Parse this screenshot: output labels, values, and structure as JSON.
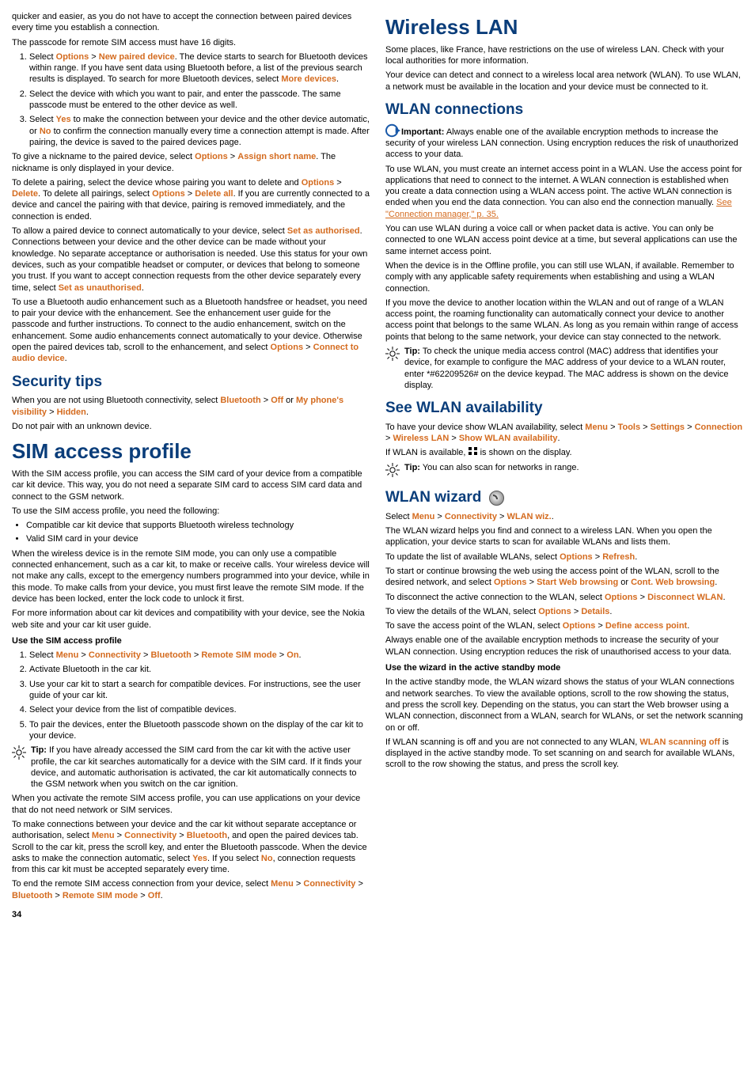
{
  "left": {
    "intro1": "quicker and easier, as you do not have to accept the connection between paired devices every time you establish a connection.",
    "intro2": "The passcode for remote SIM access must have 16 digits.",
    "pair_steps": {
      "s1a": "Select ",
      "s1_opt": "Options",
      "s1_gt1": " > ",
      "s1_npd": "New paired device",
      "s1b": ". The device starts to search for Bluetooth devices within range. If you have sent data using Bluetooth before, a list of the previous search results is displayed. To search for more Bluetooth devices, select ",
      "s1_more": "More devices",
      "s1c": ".",
      "s2": "Select the device with which you want to pair, and enter the passcode. The same passcode must be entered to the other device as well.",
      "s3a": "Select ",
      "s3_yes": "Yes",
      "s3b": " to make the connection between your device and the other device automatic, or ",
      "s3_no": "No",
      "s3c": " to confirm the connection manually every time a connection attempt is made. After pairing, the device is saved to the paired devices page."
    },
    "nick_a": "To give a nickname to the paired device, select ",
    "nick_opt": "Options",
    "nick_gt": " > ",
    "nick_asn": "Assign short name",
    "nick_b": ". The nickname is only displayed in your device.",
    "del_a": "To delete a pairing, select the device whose pairing you want to delete and ",
    "del_opt1": "Options",
    "del_gt1": " > ",
    "del_del": "Delete",
    "del_b": ". To delete all pairings, select ",
    "del_opt2": "Options",
    "del_gt2": " > ",
    "del_da": "Delete all",
    "del_c": ". If you are currently connected to a device and cancel the pairing with that device, pairing is removed immediately, and the connection is ended.",
    "auth_a": "To allow a paired device to connect automatically to your device, select ",
    "auth_sa": "Set as authorised",
    "auth_b": ". Connections between your device and the other device can be made without your knowledge. No separate acceptance or authorisation is needed. Use this status for your own devices, such as your compatible headset or computer, or devices that belong to someone you trust. If you want to accept connection requests from the other device separately every time, select ",
    "auth_su": "Set as unauthorised",
    "auth_c": ".",
    "audio_a": "To use a Bluetooth audio enhancement such as a Bluetooth handsfree or headset, you need to pair your device with the enhancement. See the enhancement user guide for the passcode and further instructions. To connect to the audio enhancement, switch on the enhancement. Some audio enhancements connect automatically to your device. Otherwise open the paired devices tab, scroll to the enhancement, and select ",
    "audio_opt": "Options",
    "audio_gt": " > ",
    "audio_cad": "Connect to audio device",
    "audio_b": ".",
    "sec_h": "Security tips",
    "sec_a": "When you are not using Bluetooth connectivity, select ",
    "sec_bt": "Bluetooth",
    "sec_gt1": " > ",
    "sec_off": "Off",
    "sec_or": " or ",
    "sec_vis": "My phone's visibility",
    "sec_gt2": " > ",
    "sec_hid": "Hidden",
    "sec_b": ".",
    "sec_c": "Do not pair with an unknown device.",
    "sim_h": "SIM access profile",
    "sim_p1": "With the SIM access profile, you can access the SIM card of your device from a compatible car kit device. This way, you do not need a separate SIM card to access SIM card data and connect to the GSM network.",
    "sim_p2": "To use the SIM access profile, you need the following:",
    "sim_b1": "Compatible car kit device that supports Bluetooth wireless technology",
    "sim_b2": "Valid SIM card in your device",
    "sim_p3": "When the wireless device is in the remote SIM mode, you can only use a compatible connected enhancement, such as a car kit, to make or receive calls. Your wireless device will not make any calls, except to the emergency numbers programmed into your device, while in this mode. To make calls from your device, you must first leave the remote SIM mode. If the device has been locked, enter the lock code to unlock it first.",
    "sim_p4": "For more information about car kit devices and compatibility with your device, see the Nokia web site and your car kit user guide.",
    "sim_h3": "Use the SIM access profile",
    "sim_s1a": "Select ",
    "sim_menu": "Menu",
    "sim_gt1": " > ",
    "sim_conn": "Connectivity",
    "sim_gt2": " > ",
    "sim_bt": "Bluetooth",
    "sim_gt3": " > ",
    "sim_rsm": "Remote SIM mode",
    "sim_gt4": " > ",
    "sim_on": "On",
    "sim_s1b": ".",
    "sim_s2": "Activate Bluetooth in the car kit.",
    "sim_s3": "Use your car kit to start a search for compatible devices. For instructions, see the user guide of your car kit.",
    "sim_s4": "Select your device from the list of compatible devices.",
    "sim_s5": "To pair the devices, enter the Bluetooth passcode shown on the display of the car kit to your device.",
    "sim_tip_l": "Tip:",
    "sim_tip": " If you have already accessed the SIM card from the car kit with the active user profile, the car kit searches automatically for a device with the SIM card. If it finds your device, and automatic authorisation is activated, the car kit automatically connects to the GSM network when you switch on the car ignition.",
    "sim_p5": "When you activate the remote SIM access profile, you can use applications on your device that do not need network or SIM services.",
    "sim_p6a": "To make connections between your device and the car kit without separate acceptance or authorisation, select ",
    "p6_menu": "Menu",
    "p6_gt1": " > ",
    "p6_conn": "Connectivity",
    "p6_gt2": " > ",
    "p6_bt": "Bluetooth",
    "sim_p6b": ", and open the paired devices tab. Scroll to the car kit, press the scroll key, and enter the Bluetooth passcode. When the device asks to make the connection automatic, select ",
    "p6_yes": "Yes",
    "sim_p6c": ". If you select ",
    "p6_no": "No",
    "sim_p6d": ", connection requests from this car kit must be accepted separately every time.",
    "sim_p7a": "To end the remote SIM access connection from your device, select ",
    "p7_menu": "Menu",
    "p7_gt1": " > ",
    "p7_conn": "Connectivity",
    "p7_gt2": " > ",
    "p7_bt": "Bluetooth",
    "p7_gt3": " > ",
    "p7_rsm": "Remote SIM mode",
    "p7_gt4": " > ",
    "p7_off": "Off",
    "sim_p7b": ".",
    "page_num": "34"
  },
  "right": {
    "wlan_h": "Wireless LAN",
    "wlan_p1": "Some places, like France, have restrictions on the use of wireless LAN. Check with your local authorities for more information.",
    "wlan_p2": "Your device can detect and connect to a wireless local area network (WLAN). To use WLAN, a network must be available in the location and your device must be connected to it.",
    "wc_h": "WLAN connections",
    "imp_l": "Important:",
    "imp": "  Always enable one of the available encryption methods to increase the security of your wireless LAN connection. Using encryption reduces the risk of unauthorized access to your data.",
    "wc_p2a": "To use WLAN, you must create an internet access point in a WLAN. Use the access point for applications that need to connect to the internet. A WLAN connection is established when you create a data connection using a WLAN access point. The active WLAN connection is ended when you end the data connection. You can also end the connection manually. ",
    "wc_link": "See \"Connection manager,\" p. 35.",
    "wc_p3": "You can use WLAN during a voice call or when packet data is active. You can only be connected to one WLAN access point device at a time, but several applications can use the same internet access point.",
    "wc_p4": "When the device is in the Offline profile, you can still use WLAN, if available. Remember to comply with any applicable safety requirements when establishing and using a WLAN connection.",
    "wc_p5": "If you move the device to another location within the WLAN and out of range of a WLAN access point, the roaming functionality can automatically connect your device to another access point that belongs to the same WLAN. As long as you remain within range of access points that belong to the same network, your device can stay connected to the network.",
    "wc_tip_l": "Tip:",
    "wc_tip": " To check the unique media access control (MAC) address that identifies your device, for example to configure the MAC address of your device to a WLAN router, enter *#62209526# on the device keypad. The MAC address is shown on the device display.",
    "av_h": "See WLAN availability",
    "av_p1a": "To have your device show WLAN availability, select ",
    "av_menu": "Menu",
    "av_gt1": " > ",
    "av_tools": "Tools",
    "av_gt2": " > ",
    "av_set": "Settings",
    "av_gt3": " > ",
    "av_conn": "Connection",
    "av_gt4": " > ",
    "av_wl": "Wireless LAN",
    "av_gt5": " > ",
    "av_swa": "Show WLAN availability",
    "av_p1b": ".",
    "av_p2a": "If WLAN is available, ",
    "av_p2b": " is shown on the display.",
    "av_tip_l": "Tip:",
    "av_tip": " You can also scan for networks in range.",
    "wz_h": "WLAN wizard",
    "wz_p1a": "Select ",
    "wz_menu": "Menu",
    "wz_gt1": " > ",
    "wz_conn": "Connectivity",
    "wz_gt2": " > ",
    "wz_ww": "WLAN wiz.",
    "wz_p1b": ".",
    "wz_p2": "The WLAN wizard helps you find and connect to a wireless LAN. When you open the application, your device starts to scan for available WLANs and lists them.",
    "wz_p3a": "To update the list of available WLANs, select ",
    "wz_opt1": "Options",
    "wz_gt3": " > ",
    "wz_ref": "Refresh",
    "wz_p3b": ".",
    "wz_p4a": "To start or continue browsing the web using the access point of the WLAN, scroll to the desired network, and select ",
    "wz_opt2": "Options",
    "wz_gt4": " > ",
    "wz_swb": "Start Web browsing",
    "wz_or": " or ",
    "wz_cwb": "Cont. Web browsing",
    "wz_p4b": ".",
    "wz_p5a": "To disconnect the active connection to the WLAN, select ",
    "wz_opt3": "Options",
    "wz_gt5": " > ",
    "wz_dw": "Disconnect WLAN",
    "wz_p5b": ".",
    "wz_p6a": "To view the details of the WLAN, select ",
    "wz_opt4": "Options",
    "wz_gt6": " > ",
    "wz_det": "Details",
    "wz_p6b": ".",
    "wz_p7a": "To save the access point of the WLAN, select ",
    "wz_opt5": "Options",
    "wz_gt7": " > ",
    "wz_dap": "Define access point",
    "wz_p7b": ".",
    "wz_p8": "Always enable one of the available encryption methods to increase the security of your WLAN connection. Using encryption reduces the risk of unauthorised access to your data.",
    "wz_h3": "Use the wizard in the active standby mode",
    "wz_p9": "In the active standby mode, the WLAN wizard shows the status of your WLAN connections and network searches. To view the available options, scroll to the row showing the status, and press the scroll key. Depending on the status, you can start the Web browser using a WLAN connection, disconnect from a WLAN, search for WLANs, or set the network scanning on or off.",
    "wz_p10a": "If WLAN scanning is off and you are not connected to any WLAN, ",
    "wz_wso": "WLAN scanning off",
    "wz_p10b": " is displayed in the active standby mode. To set scanning on and search for available WLANs, scroll to the row showing the status, and press the scroll key."
  }
}
